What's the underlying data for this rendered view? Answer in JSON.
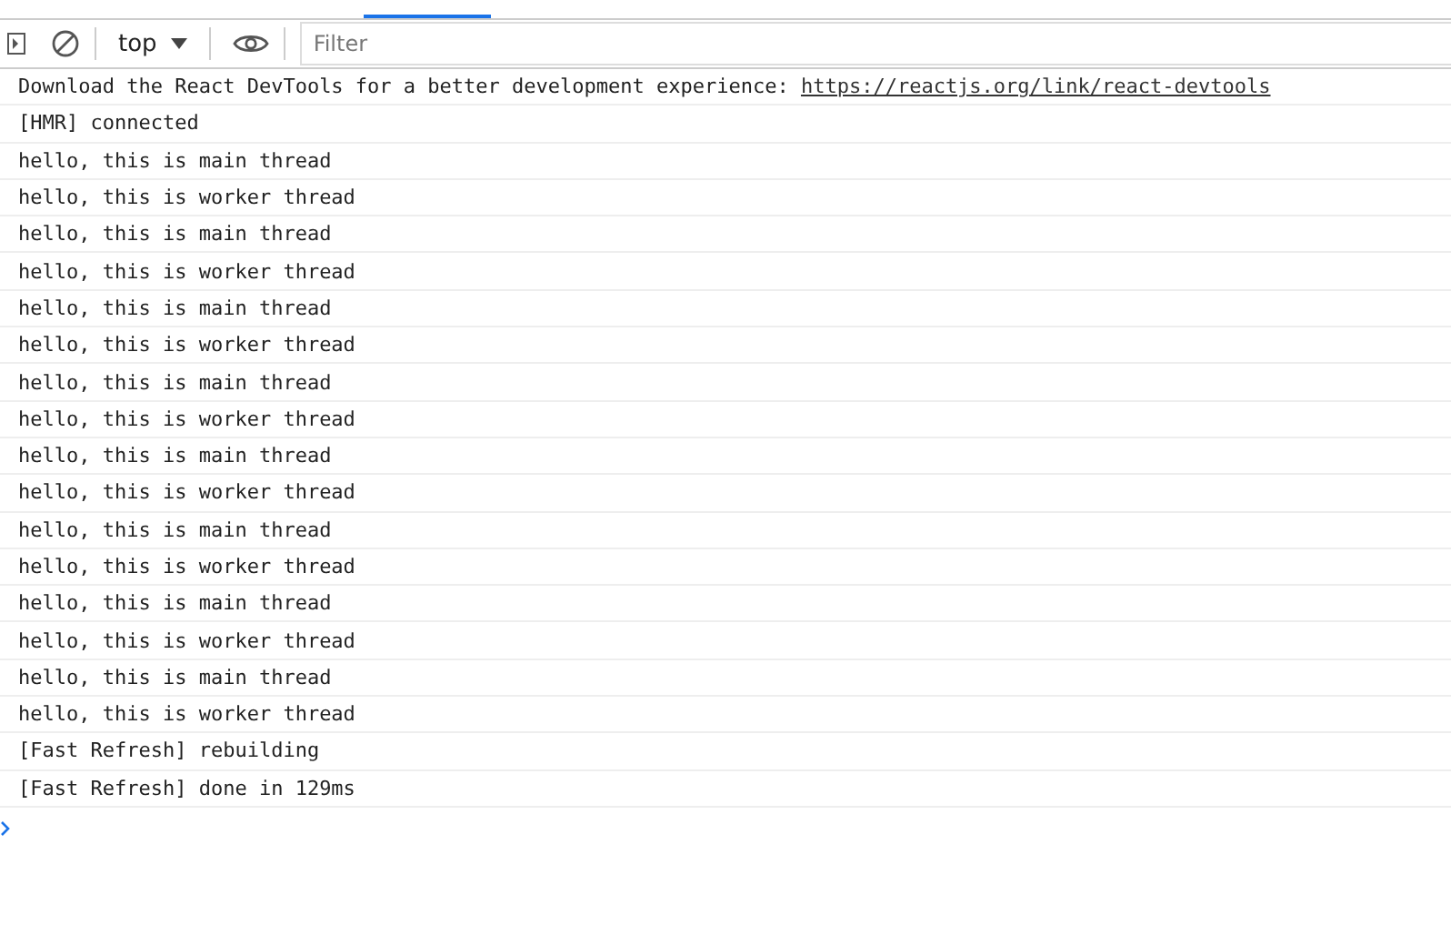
{
  "toolbar": {
    "context": "top",
    "filter": {
      "placeholder": "Filter"
    }
  },
  "messages": [
    {
      "text": "Download the React DevTools for a better development experience: ",
      "link": "https://reactjs.org/link/react-devtools"
    },
    {
      "text": "[HMR] connected"
    },
    {
      "text": "hello, this is main thread"
    },
    {
      "text": "hello, this is worker thread"
    },
    {
      "text": "hello, this is main thread"
    },
    {
      "text": "hello, this is worker thread"
    },
    {
      "text": "hello, this is main thread"
    },
    {
      "text": "hello, this is worker thread"
    },
    {
      "text": "hello, this is main thread"
    },
    {
      "text": "hello, this is worker thread"
    },
    {
      "text": "hello, this is main thread"
    },
    {
      "text": "hello, this is worker thread"
    },
    {
      "text": "hello, this is main thread"
    },
    {
      "text": "hello, this is worker thread"
    },
    {
      "text": "hello, this is main thread"
    },
    {
      "text": "hello, this is worker thread"
    },
    {
      "text": "hello, this is main thread"
    },
    {
      "text": "hello, this is worker thread"
    },
    {
      "text": "[Fast Refresh] rebuilding"
    },
    {
      "text": "[Fast Refresh] done in 129ms"
    }
  ]
}
